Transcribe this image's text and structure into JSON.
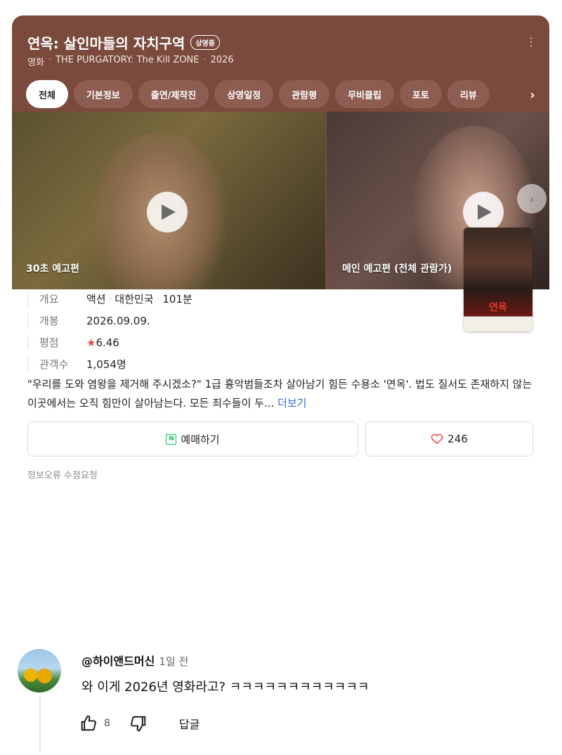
{
  "movie": {
    "title": "연옥: 살인마들의 자치구역",
    "status_badge": "상영중",
    "type": "영화",
    "english_title": "THE PURGATORY: The Kill ZONE",
    "year": "2026"
  },
  "tabs": [
    "전체",
    "기본정보",
    "출연/제작진",
    "상영일정",
    "관람평",
    "무비클립",
    "포토",
    "리뷰"
  ],
  "active_tab": "전체",
  "videos": [
    {
      "label": "30초 예고편"
    },
    {
      "label": "메인 예고편 (전체 관람가)"
    }
  ],
  "poster": {
    "title_text": "연옥"
  },
  "info": {
    "overview_label": "개요",
    "genre": "액션",
    "country": "대한민국",
    "runtime": "101분",
    "release_label": "개봉",
    "release_date": "2026.09.09.",
    "rating_label": "평점",
    "rating": "6.46",
    "audience_label": "관객수",
    "audience": "1,054명"
  },
  "description": {
    "text": "\"우리를 도와 염왕을 제거해 주시겠소?\" 1급 흉악범들조차 살아남기 힘든 수용소 '연옥'. 법도 질서도 존재하지 않는 이곳에서는 오직 힘만이 살아남는다. 모든 죄수들이 두...",
    "more": "더보기"
  },
  "buttons": {
    "book_label": "예매하기",
    "like_count": "246"
  },
  "report_link": "정보오류 수정요청",
  "comment": {
    "author": "@하이앤드머신",
    "time": "1일 전",
    "text": "와 이게 2026년 영화라고? ㅋㅋㅋㅋㅋㅋㅋㅋㅋㅋㅋㅋ",
    "like_count": "8",
    "reply_label": "답글"
  },
  "colors": {
    "header_bg": "#7a4a3c",
    "star": "#e8473b",
    "link": "#2f6bd6",
    "naver_green": "#03c75a"
  }
}
